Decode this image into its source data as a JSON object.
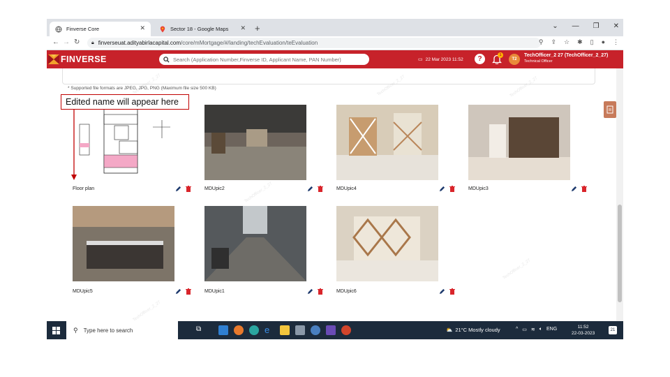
{
  "browser": {
    "tabs": [
      {
        "title": "Finverse Core"
      },
      {
        "title": "Sector 18 - Google Maps"
      }
    ],
    "url_host": "finverseuat.adityabirlacapital.com",
    "url_path": "/core/mMortgage/#/landing/techEvaluation/teEvaluation"
  },
  "app": {
    "brand": "FINVERSE",
    "search_placeholder": "Search (Application Number,Finverse ID, Applicant Name, PAN Number)",
    "datetime": "22 Mar 2023 11:52",
    "notification_count": "1",
    "avatar_initials": "T2",
    "user_name": "TechOfficer_2 27 (TechOfficer_2_27)",
    "user_role": "Technical Officer",
    "brand_color": "#c7222a"
  },
  "main": {
    "format_note": "* Supported file formats are JPEG, JPG, PNG (Maximum file size 500 KB)",
    "watermark": "TechOfficer_2_27",
    "photos": [
      {
        "name": "Floor plan"
      },
      {
        "name": "MDUpic2"
      },
      {
        "name": "MDUpic4"
      },
      {
        "name": "MDUpic3"
      },
      {
        "name": "MDUpic5"
      },
      {
        "name": "MDUpic1"
      },
      {
        "name": "MDUpic6"
      }
    ]
  },
  "annotation": {
    "callout_text": "Edited name will appear here"
  },
  "taskbar": {
    "search_placeholder": "Type here to search",
    "weather": "21°C  Mostly cloudy",
    "lang": "ENG",
    "time": "11:52",
    "date": "22-03-2023",
    "notif_count": "21"
  }
}
